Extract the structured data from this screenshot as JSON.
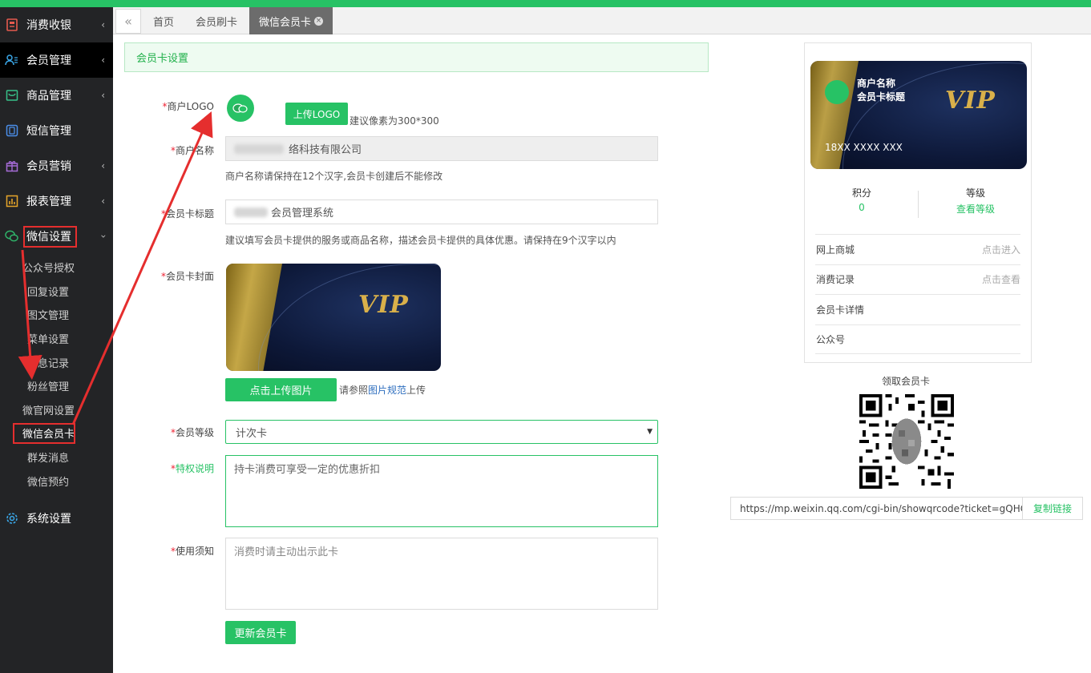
{
  "sidebar": {
    "items": [
      {
        "label": "消费收银",
        "icon": "cash-register-icon",
        "has_sub": true
      },
      {
        "label": "会员管理",
        "icon": "members-icon",
        "has_sub": true
      },
      {
        "label": "商品管理",
        "icon": "goods-icon",
        "has_sub": true
      },
      {
        "label": "短信管理",
        "icon": "sms-icon",
        "has_sub": false
      },
      {
        "label": "会员营销",
        "icon": "gift-icon",
        "has_sub": true
      },
      {
        "label": "报表管理",
        "icon": "report-icon",
        "has_sub": true
      },
      {
        "label": "微信设置",
        "icon": "wechat-icon",
        "has_sub": true,
        "expanded": true
      }
    ],
    "wechat_sub": [
      "公众号授权",
      "回复设置",
      "图文管理",
      "菜单设置",
      "消息记录",
      "粉丝管理",
      "微官网设置",
      "微信会员卡",
      "群发消息",
      "微信预约"
    ],
    "system_label": "系统设置"
  },
  "tabs": {
    "items": [
      "首页",
      "会员刷卡",
      "微信会员卡"
    ],
    "active_index": 2
  },
  "banner": {
    "title": "会员卡设置"
  },
  "form": {
    "logo_label": "商户LOGO",
    "upload_logo_btn": "上传LOGO",
    "logo_hint": "建议像素为300*300",
    "name_label": "商户名称",
    "name_value": "络科技有限公司",
    "name_help": "商户名称请保持在12个汉字,会员卡创建后不能修改",
    "title_label": "会员卡标题",
    "title_value": "会员管理系统",
    "title_help": "建议填写会员卡提供的服务或商品名称，描述会员卡提供的具体优惠。请保持在9个汉字以内",
    "cover_label": "会员卡封面",
    "upload_cover_btn": "点击上传图片",
    "cover_hint_pre": "请参照",
    "cover_hint_link": "图片规范",
    "cover_hint_post": "上传",
    "level_label": "会员等级",
    "level_value": "计次卡",
    "privilege_label": "特权说明",
    "privilege_value": "持卡消费可享受一定的优惠折扣",
    "notice_label": "使用须知",
    "notice_value": "消费时请主动出示此卡",
    "submit_btn": "更新会员卡",
    "required_mark": "*"
  },
  "preview": {
    "merchant_name": "商户名称",
    "card_title": "会员卡标题",
    "card_number": "18XX XXXX XXX",
    "vip_text": "VIP",
    "points_label": "积分",
    "points_value": "0",
    "level_label": "等级",
    "level_link": "查看等级",
    "rows": [
      {
        "label": "网上商城",
        "hint": "点击进入"
      },
      {
        "label": "消费记录",
        "hint": "点击查看"
      },
      {
        "label": "会员卡详情",
        "hint": ""
      },
      {
        "label": "公众号",
        "hint": ""
      }
    ]
  },
  "qr": {
    "title": "领取会员卡",
    "url": "https://mp.weixin.qq.com/cgi-bin/showqrcode?ticket=gQHC",
    "copy_btn": "复制链接"
  },
  "colors": {
    "brand_green": "#27c265",
    "sidebar_bg": "#232426",
    "annotation_red": "#e52e2e"
  }
}
